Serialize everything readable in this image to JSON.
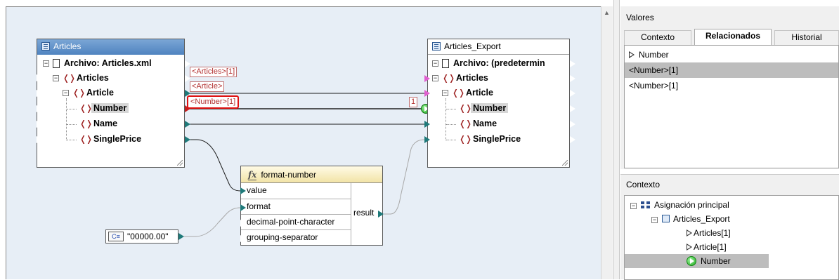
{
  "articles_component": {
    "title": "Articles",
    "file_row": "Archivo: Articles.xml",
    "nodes": [
      "Articles",
      "Article",
      "Number",
      "Name",
      "SinglePrice"
    ]
  },
  "export_component": {
    "title": "Articles_Export",
    "file_row": "Archivo: (predetermin",
    "nodes": [
      "Articles",
      "Article",
      "Number",
      "Name",
      "SinglePrice"
    ]
  },
  "wire_labels": {
    "articles": "<Articles>[1]",
    "article": "<Article>",
    "number": "<Number>[1]",
    "count": "1"
  },
  "function": {
    "name": "format-number",
    "params": [
      "value",
      "format",
      "decimal-point-character",
      "grouping-separator"
    ],
    "result": "result"
  },
  "constant": {
    "badge": "C≡",
    "value": "\"00000.00\""
  },
  "values_panel": {
    "title": "Valores",
    "tabs": [
      "Contexto",
      "Relacionados",
      "Historial"
    ],
    "active_tab": "Relacionados",
    "items": [
      "Number",
      "<Number>[1]",
      "<Number>[1]"
    ]
  },
  "context_panel": {
    "title": "Contexto",
    "items": [
      "Asignación principal",
      "Articles_Export",
      "Articles[1]",
      "Article[1]",
      "Number"
    ]
  },
  "colors": {
    "canvas_bg": "#e7eef6",
    "component_header": "#4f83c0",
    "connection_teal": "#1f7a7a",
    "highlight_red": "#e01010",
    "function_header": "#f2e3a6"
  }
}
